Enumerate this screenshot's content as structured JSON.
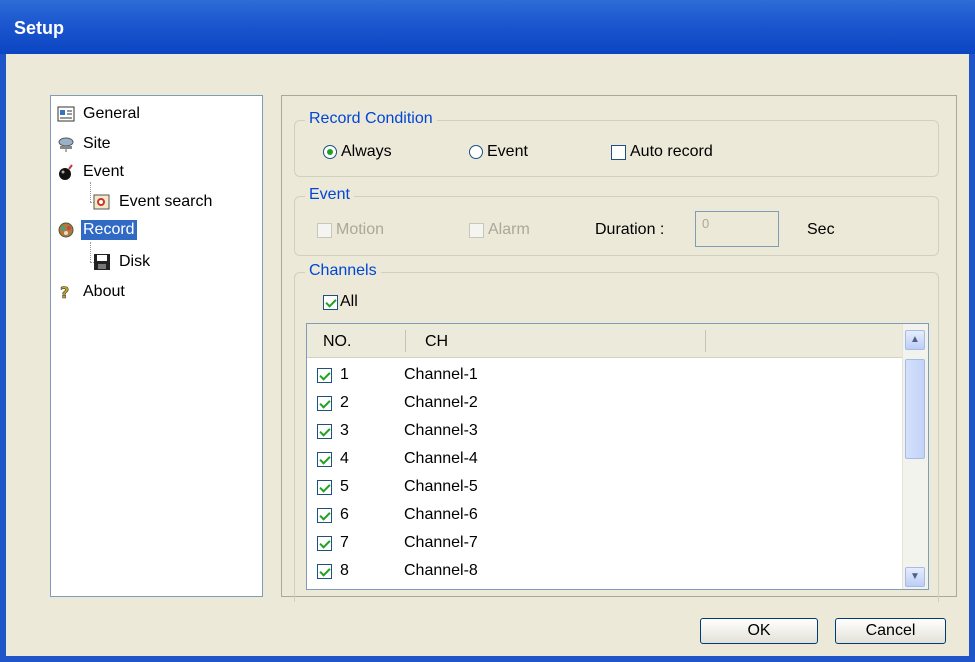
{
  "window": {
    "title": "Setup"
  },
  "tree": {
    "items": [
      {
        "label": "General",
        "icon": "general-icon"
      },
      {
        "label": "Site",
        "icon": "site-icon"
      },
      {
        "label": "Event",
        "icon": "event-icon"
      },
      {
        "label": "Event search",
        "icon": "event-search-icon"
      },
      {
        "label": "Record",
        "icon": "record-icon",
        "selected": true
      },
      {
        "label": "Disk",
        "icon": "disk-icon"
      },
      {
        "label": "About",
        "icon": "about-icon"
      }
    ]
  },
  "record_condition": {
    "legend": "Record Condition",
    "always_label": "Always",
    "event_label": "Event",
    "auto_record_label": "Auto record",
    "selected": "Always",
    "auto_record_checked": false
  },
  "event": {
    "legend": "Event",
    "motion_label": "Motion",
    "alarm_label": "Alarm",
    "duration_label": "Duration :",
    "duration_value": "0",
    "unit": "Sec"
  },
  "channels": {
    "legend": "Channels",
    "all_label": "All",
    "all_checked": true,
    "col_no": "NO.",
    "col_ch": "CH",
    "rows": [
      {
        "no": "1",
        "ch": "Channel-1",
        "checked": true
      },
      {
        "no": "2",
        "ch": "Channel-2",
        "checked": true
      },
      {
        "no": "3",
        "ch": "Channel-3",
        "checked": true
      },
      {
        "no": "4",
        "ch": "Channel-4",
        "checked": true
      },
      {
        "no": "5",
        "ch": "Channel-5",
        "checked": true
      },
      {
        "no": "6",
        "ch": "Channel-6",
        "checked": true
      },
      {
        "no": "7",
        "ch": "Channel-7",
        "checked": true
      },
      {
        "no": "8",
        "ch": "Channel-8",
        "checked": true
      }
    ]
  },
  "buttons": {
    "ok": "OK",
    "cancel": "Cancel"
  }
}
